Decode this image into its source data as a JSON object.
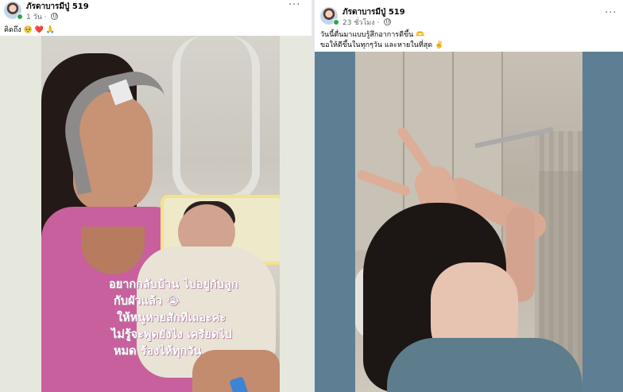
{
  "left_post": {
    "author": "ภัรดาบารมีปู่ 519",
    "time": "1 วัน",
    "caption": "คิดถึง",
    "caption_emojis": "🥺 ❤️ 🙏",
    "overlay_lines": [
      "อยากกลับบ้าน ไปอยู่กับลูก",
      "กับผัวแล้ว 😭",
      "ให้หนูหายสักทีเถอะค่ะ",
      "ไม่รู้จะพูดยังไง เครียดไป",
      "หมด ร้องไห้ทุกวัน"
    ]
  },
  "right_post": {
    "author": "ภัรดาบารมีปู่ 519",
    "time": "23 ชั่วโมง",
    "caption_line1": "วันนี้ตื่นมาแบบรู้สึกอาการดีขึ้น",
    "caption_line1_emoji": "🫶",
    "caption_line2": "ขอให้ดีขึ้นในทุกๆวัน และหายในที่สุด",
    "caption_line2_emoji": "✌️"
  },
  "icons": [
    "avatar",
    "globe-icon",
    "more-options-icon"
  ],
  "colors": {
    "background_gutter": "#e6e8dd",
    "right_gutter": "#5e7f93",
    "meta_text": "#65676b"
  }
}
